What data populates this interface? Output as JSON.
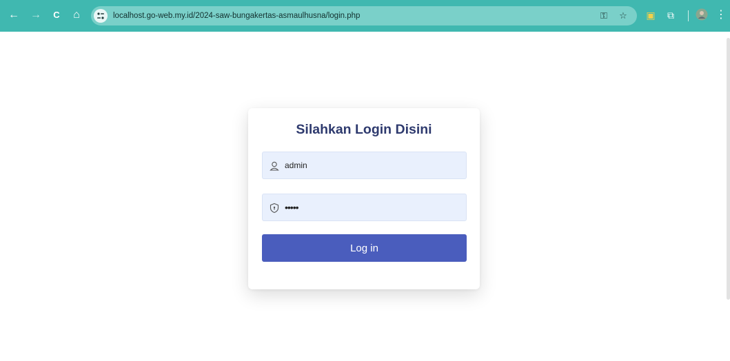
{
  "browser": {
    "nav": {
      "back": "←",
      "forward": "→",
      "reload": "C",
      "home": "⌂"
    },
    "url": "localhost.go-web.my.id/2024-saw-bungakertas-asmaulhusna/login.php",
    "omnibox_icons": {
      "key": "⚿",
      "bookmark": "☆"
    },
    "toolbar_icons": {
      "extension": "▣",
      "puzzle": "⧉",
      "menu": "⋮"
    },
    "accent_color": "#40b8b0"
  },
  "login": {
    "title": "Silahkan Login Disini",
    "username": {
      "value": "admin",
      "icon": "user-icon"
    },
    "password": {
      "value": "•••••",
      "icon": "shield-icon"
    },
    "submit_label": "Log in",
    "button_color": "#4a5dbd"
  }
}
